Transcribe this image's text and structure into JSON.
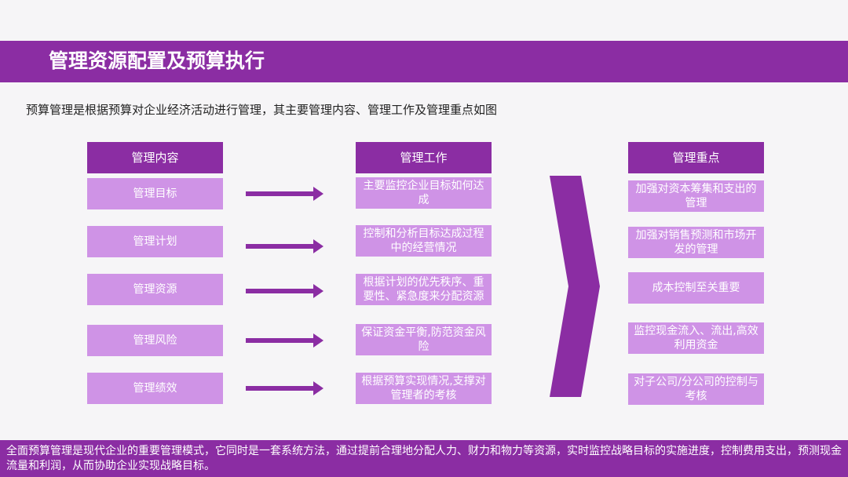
{
  "title": "管理资源配置及预算执行",
  "intro": "预算管理是根据预算对企业经济活动进行管理，其主要管理内容、管理工作及管理重点如图",
  "columns": [
    {
      "header": "管理内容",
      "items": [
        "管理目标",
        "管理计划",
        "管理资源",
        "管理风险",
        "管理绩效"
      ]
    },
    {
      "header": "管理工作",
      "items": [
        "主要监控企业目标如何达成",
        "控制和分析目标达成过程中的经营情况",
        "根据计划的优先秩序、重要性、紧急度来分配资源",
        "保证资金平衡,防范资金风险",
        "根据预算实现情况,支撑对管理者的考核"
      ]
    },
    {
      "header": "管理重点",
      "items": [
        "加强对资本筹集和支出的管理",
        "加强对销售预测和市场开发的管理",
        "成本控制至关重要",
        "监控现金流入、流出,高效利用资金",
        "对子公司/分公司的控制与考核"
      ]
    }
  ],
  "footer": "全面预算管理是现代企业的重要管理模式，它同时是一套系统方法，通过提前合理地分配人力、财力和物力等资源，实时监控战略目标的实施进度，控制费用支出，预测现金流量和利润，从而协助企业实现战略目标。",
  "colors": {
    "accent": "#8b2da3",
    "item_fill": "#cf93e6",
    "background": "#f6f5f7"
  }
}
